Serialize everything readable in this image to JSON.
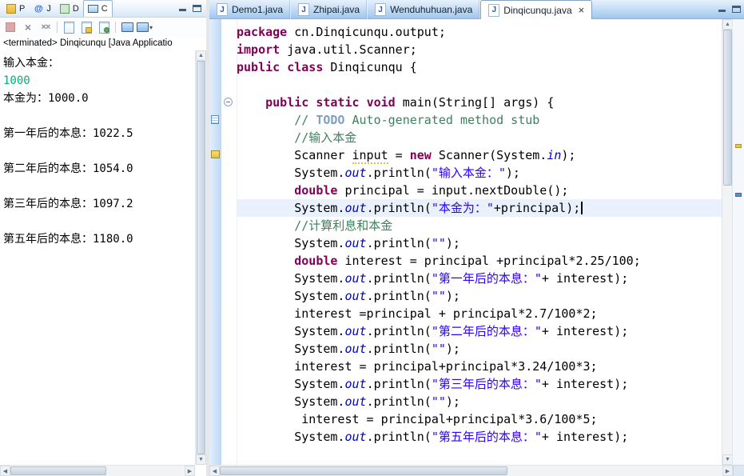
{
  "colors": {
    "k": "#7f0055",
    "s": "#2a00ff",
    "c": "#3f7f5f",
    "t": "#7f9fbf",
    "f": "#0000c0",
    "in": "#00b26e",
    "hl": "#e8f1fc"
  },
  "console": {
    "view_tabs": [
      {
        "label": "P",
        "icon": "problems",
        "active": false
      },
      {
        "label": "J",
        "icon": "javadoc",
        "active": false
      },
      {
        "label": "D",
        "icon": "declaration",
        "active": false
      },
      {
        "label": "C",
        "icon": "console",
        "active": true
      }
    ],
    "toolbar": [
      {
        "name": "terminate"
      },
      {
        "name": "remove-launch"
      },
      {
        "name": "remove-all-launches"
      },
      {
        "name": "separator"
      },
      {
        "name": "clear-console"
      },
      {
        "name": "scroll-lock"
      },
      {
        "name": "pin-console"
      },
      {
        "name": "separator"
      },
      {
        "name": "display-selected-console"
      },
      {
        "name": "open-console"
      }
    ],
    "status": "<terminated> Dinqicunqu [Java Applicatio",
    "lines": [
      {
        "t": "输入本金：",
        "k": "out"
      },
      {
        "t": "1000",
        "k": "in"
      },
      {
        "t": "本金为：1000.0",
        "k": "out"
      },
      {
        "t": "",
        "k": "out"
      },
      {
        "t": "第一年后的本息：1022.5",
        "k": "out"
      },
      {
        "t": "",
        "k": "out"
      },
      {
        "t": "第二年后的本息：1054.0",
        "k": "out"
      },
      {
        "t": "",
        "k": "out"
      },
      {
        "t": "第三年后的本息：1097.2",
        "k": "out"
      },
      {
        "t": "",
        "k": "out"
      },
      {
        "t": "第五年后的本息：1180.0",
        "k": "out"
      }
    ]
  },
  "editor": {
    "tabs": [
      {
        "label": "Demo1.java",
        "active": false
      },
      {
        "label": "Zhipai.java",
        "active": false
      },
      {
        "label": "Wenduhuhuan.java",
        "active": false
      },
      {
        "label": "Dinqicunqu.java",
        "active": true
      }
    ],
    "fold_markers": [
      4
    ],
    "ruler_markers": [
      {
        "line": 5,
        "type": "task"
      },
      {
        "line": 7,
        "type": "warning"
      }
    ],
    "overview_marks": [
      {
        "top_pct": 28,
        "color": "#e3c94c"
      },
      {
        "top_pct": 39,
        "color": "#5b8fc9"
      }
    ],
    "code_lines": [
      {
        "segs": [
          {
            "c": "k",
            "t": "package"
          },
          {
            "c": "p",
            "t": " cn.Dinqicunqu.output;"
          }
        ]
      },
      {
        "segs": [
          {
            "c": "k",
            "t": "import"
          },
          {
            "c": "p",
            "t": " java.util.Scanner;"
          }
        ]
      },
      {
        "segs": [
          {
            "c": "k",
            "t": "public"
          },
          {
            "c": "p",
            "t": " "
          },
          {
            "c": "k",
            "t": "class"
          },
          {
            "c": "p",
            "t": " Dinqicunqu {"
          }
        ]
      },
      {
        "segs": []
      },
      {
        "segs": [
          {
            "c": "p",
            "t": "    "
          },
          {
            "c": "k",
            "t": "public"
          },
          {
            "c": "p",
            "t": " "
          },
          {
            "c": "k",
            "t": "static"
          },
          {
            "c": "p",
            "t": " "
          },
          {
            "c": "k",
            "t": "void"
          },
          {
            "c": "p",
            "t": " main(String[] args) {"
          }
        ]
      },
      {
        "segs": [
          {
            "c": "p",
            "t": "        "
          },
          {
            "c": "c",
            "t": "// "
          },
          {
            "c": "t",
            "t": "TODO"
          },
          {
            "c": "c",
            "t": " Auto-generated method stub"
          }
        ]
      },
      {
        "segs": [
          {
            "c": "p",
            "t": "        "
          },
          {
            "c": "c",
            "t": "//输入本金"
          }
        ]
      },
      {
        "segs": [
          {
            "c": "p",
            "t": "        Scanner "
          },
          {
            "c": "w",
            "t": "input"
          },
          {
            "c": "p",
            "t": " = "
          },
          {
            "c": "k",
            "t": "new"
          },
          {
            "c": "p",
            "t": " Scanner(System."
          },
          {
            "c": "f",
            "t": "in"
          },
          {
            "c": "p",
            "t": ");"
          }
        ]
      },
      {
        "segs": [
          {
            "c": "p",
            "t": "        System."
          },
          {
            "c": "f",
            "t": "out"
          },
          {
            "c": "p",
            "t": ".println("
          },
          {
            "c": "s",
            "t": "\"输入本金：\""
          },
          {
            "c": "p",
            "t": ");"
          }
        ]
      },
      {
        "segs": [
          {
            "c": "p",
            "t": "        "
          },
          {
            "c": "k",
            "t": "double"
          },
          {
            "c": "p",
            "t": " principal = input.nextDouble();"
          }
        ]
      },
      {
        "hl": true,
        "cursor": true,
        "segs": [
          {
            "c": "p",
            "t": "        System."
          },
          {
            "c": "f",
            "t": "out"
          },
          {
            "c": "p",
            "t": ".println("
          },
          {
            "c": "s",
            "t": "\"本金为：\""
          },
          {
            "c": "p",
            "t": "+principal);"
          }
        ]
      },
      {
        "segs": [
          {
            "c": "p",
            "t": "        "
          },
          {
            "c": "c",
            "t": "//计算利息和本金"
          }
        ]
      },
      {
        "segs": [
          {
            "c": "p",
            "t": "        System."
          },
          {
            "c": "f",
            "t": "out"
          },
          {
            "c": "p",
            "t": ".println("
          },
          {
            "c": "s",
            "t": "\"\""
          },
          {
            "c": "p",
            "t": ");"
          }
        ]
      },
      {
        "segs": [
          {
            "c": "p",
            "t": "        "
          },
          {
            "c": "k",
            "t": "double"
          },
          {
            "c": "p",
            "t": " interest = principal +principal*2.25/100;"
          }
        ]
      },
      {
        "segs": [
          {
            "c": "p",
            "t": "        System."
          },
          {
            "c": "f",
            "t": "out"
          },
          {
            "c": "p",
            "t": ".println("
          },
          {
            "c": "s",
            "t": "\"第一年后的本息：\""
          },
          {
            "c": "p",
            "t": "+ interest);"
          }
        ]
      },
      {
        "segs": [
          {
            "c": "p",
            "t": "        System."
          },
          {
            "c": "f",
            "t": "out"
          },
          {
            "c": "p",
            "t": ".println("
          },
          {
            "c": "s",
            "t": "\"\""
          },
          {
            "c": "p",
            "t": ");"
          }
        ]
      },
      {
        "segs": [
          {
            "c": "p",
            "t": "        interest =principal + principal*2.7/100*2;"
          }
        ]
      },
      {
        "segs": [
          {
            "c": "p",
            "t": "        System."
          },
          {
            "c": "f",
            "t": "out"
          },
          {
            "c": "p",
            "t": ".println("
          },
          {
            "c": "s",
            "t": "\"第二年后的本息：\""
          },
          {
            "c": "p",
            "t": "+ interest);"
          }
        ]
      },
      {
        "segs": [
          {
            "c": "p",
            "t": "        System."
          },
          {
            "c": "f",
            "t": "out"
          },
          {
            "c": "p",
            "t": ".println("
          },
          {
            "c": "s",
            "t": "\"\""
          },
          {
            "c": "p",
            "t": ");"
          }
        ]
      },
      {
        "segs": [
          {
            "c": "p",
            "t": "        interest = principal+principal*3.24/100*3;"
          }
        ]
      },
      {
        "segs": [
          {
            "c": "p",
            "t": "        System."
          },
          {
            "c": "f",
            "t": "out"
          },
          {
            "c": "p",
            "t": ".println("
          },
          {
            "c": "s",
            "t": "\"第三年后的本息：\""
          },
          {
            "c": "p",
            "t": "+ interest);"
          }
        ]
      },
      {
        "segs": [
          {
            "c": "p",
            "t": "        System."
          },
          {
            "c": "f",
            "t": "out"
          },
          {
            "c": "p",
            "t": ".println("
          },
          {
            "c": "s",
            "t": "\"\""
          },
          {
            "c": "p",
            "t": ");"
          }
        ]
      },
      {
        "segs": [
          {
            "c": "p",
            "t": "         interest = principal+principal*3.6/100*5;"
          }
        ]
      },
      {
        "segs": [
          {
            "c": "p",
            "t": "        System."
          },
          {
            "c": "f",
            "t": "out"
          },
          {
            "c": "p",
            "t": ".println("
          },
          {
            "c": "s",
            "t": "\"第五年后的本息：\""
          },
          {
            "c": "p",
            "t": "+ interest);"
          }
        ]
      }
    ]
  }
}
